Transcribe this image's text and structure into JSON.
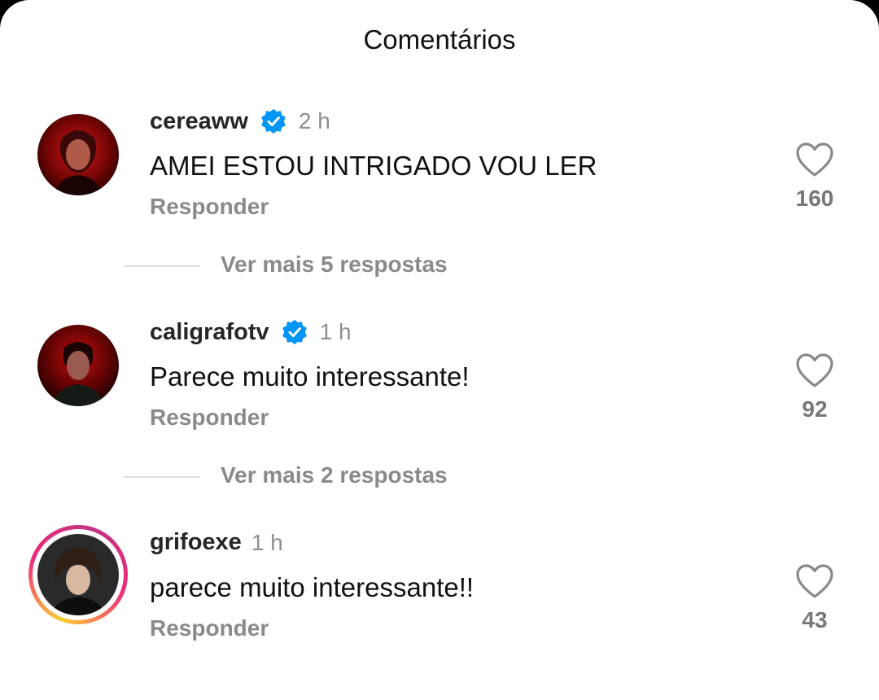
{
  "header": {
    "title": "Comentários"
  },
  "comments": [
    {
      "username": "cereaww",
      "verified": true,
      "time": "2 h",
      "text": "AMEI ESTOU INTRIGADO VOU LER",
      "reply_label": "Responder",
      "likes": "160",
      "more_replies": "Ver mais 5 respostas"
    },
    {
      "username": "caligrafotv",
      "verified": true,
      "time": "1 h",
      "text": "Parece muito interessante!",
      "reply_label": "Responder",
      "likes": "92",
      "more_replies": "Ver mais 2 respostas"
    },
    {
      "username": "grifoexe",
      "verified": false,
      "has_story": true,
      "time": "1 h",
      "text": "parece muito interessante!!",
      "reply_label": "Responder",
      "likes": "43"
    }
  ],
  "icons": {
    "verified": "verified-badge-icon",
    "like": "heart-icon"
  },
  "colors": {
    "verified_blue": "#0095f6",
    "muted_text": "#8a8a8a",
    "story_ring_start": "#f9ce34",
    "story_ring_end": "#ee2a7b"
  }
}
